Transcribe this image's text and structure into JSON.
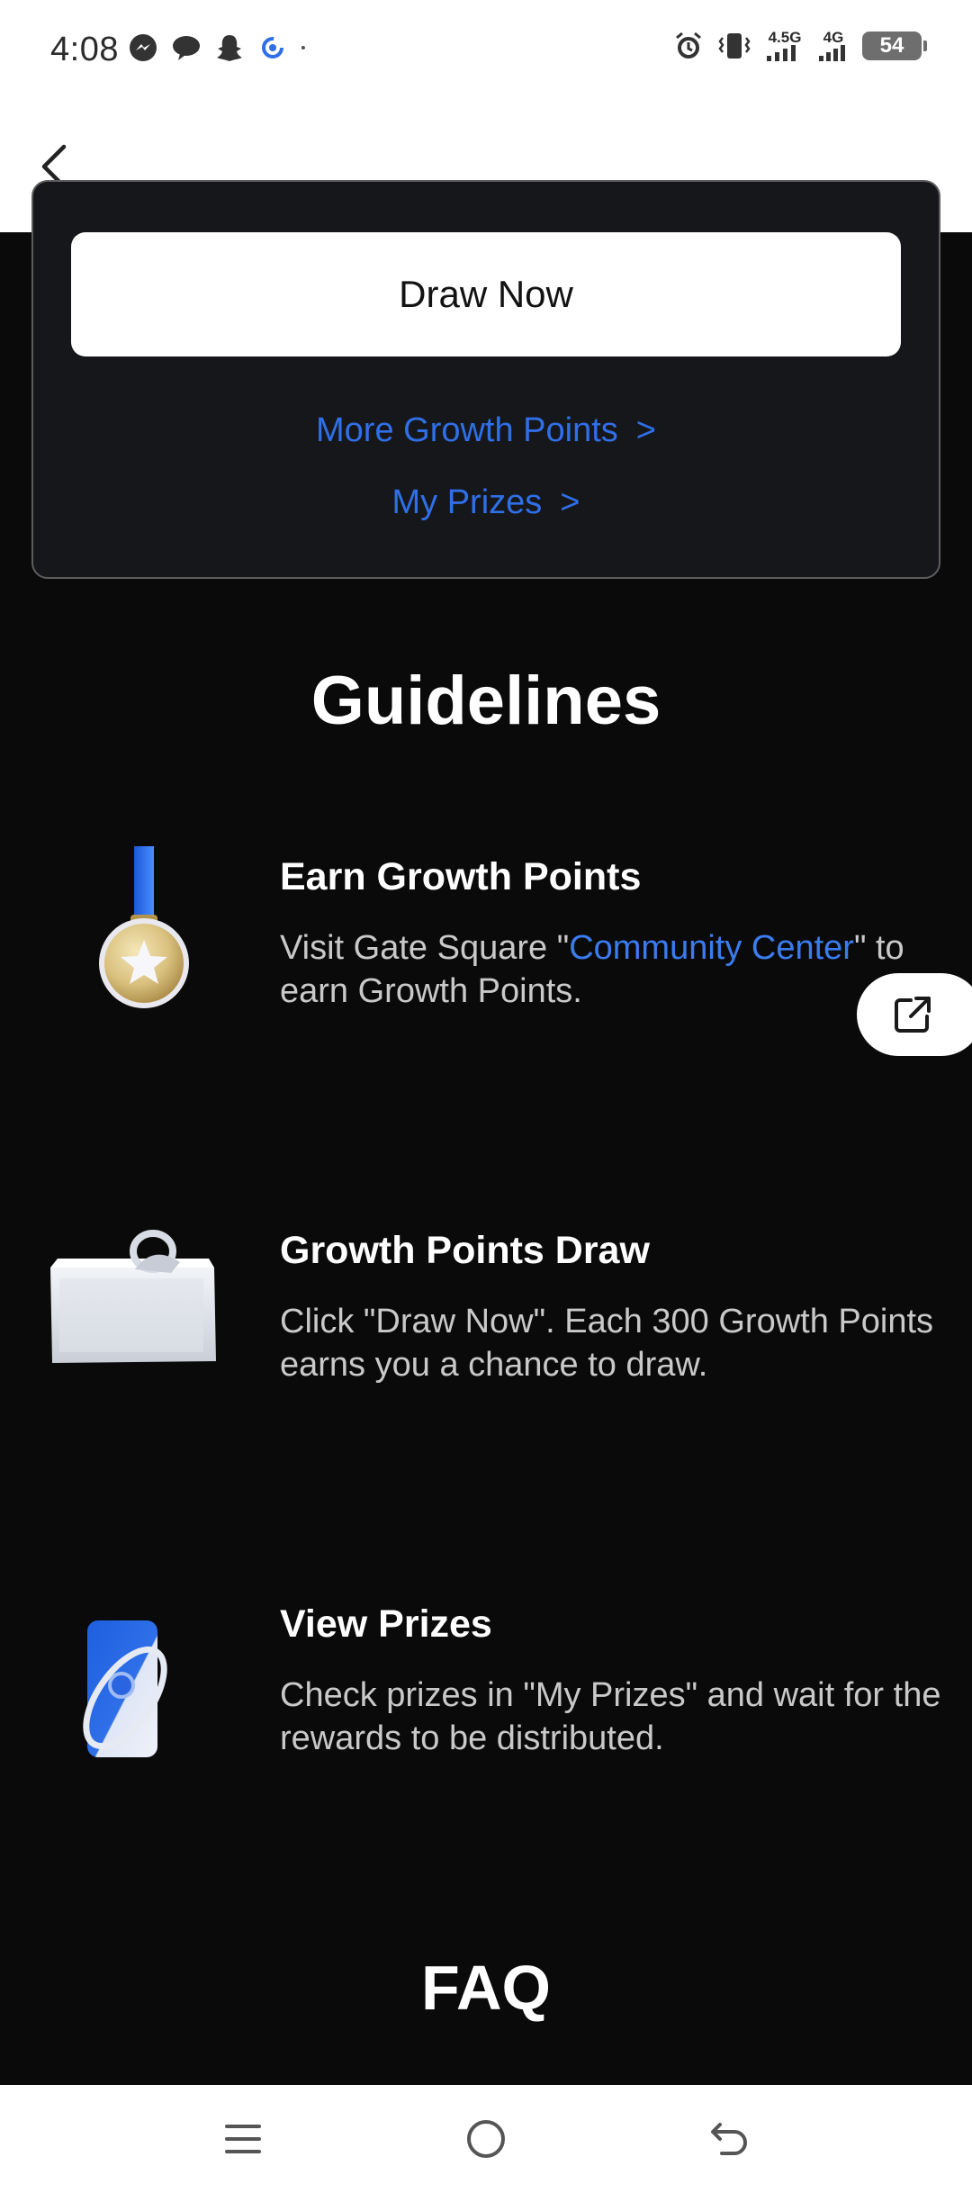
{
  "status_bar": {
    "time": "4:08",
    "left_icons": [
      "messenger-icon",
      "chat-bubble-icon",
      "snapchat-icon",
      "loading-app-icon",
      "dot-icon"
    ],
    "network_1": "4.5G",
    "network_2": "4G",
    "battery": "54"
  },
  "card": {
    "draw_button": "Draw Now",
    "link_more": "More Growth Points",
    "link_prizes": "My Prizes",
    "chevron": ">"
  },
  "guidelines": {
    "title": "Guidelines",
    "items": [
      {
        "title": "Earn Growth Points",
        "desc_before": "Visit Gate Square \"",
        "desc_link": "Community Center",
        "desc_after": "\" to earn Growth Points.",
        "icon": "medal-icon"
      },
      {
        "title": "Growth Points Draw",
        "desc": "Click \"Draw Now\". Each 300 Growth Points earns you a chance to draw.",
        "icon": "gift-box-icon"
      },
      {
        "title": "View Prizes",
        "desc": "Check prizes in \"My Prizes\" and wait for the rewards to be distributed.",
        "icon": "phone-orbit-icon"
      }
    ]
  },
  "faq": {
    "title": "FAQ"
  },
  "colors": {
    "background": "#0a0a0a",
    "card": "#16171a",
    "accent_blue": "#2f6fe8",
    "text_white": "#ffffff",
    "text_grey": "#c9c9c9"
  }
}
